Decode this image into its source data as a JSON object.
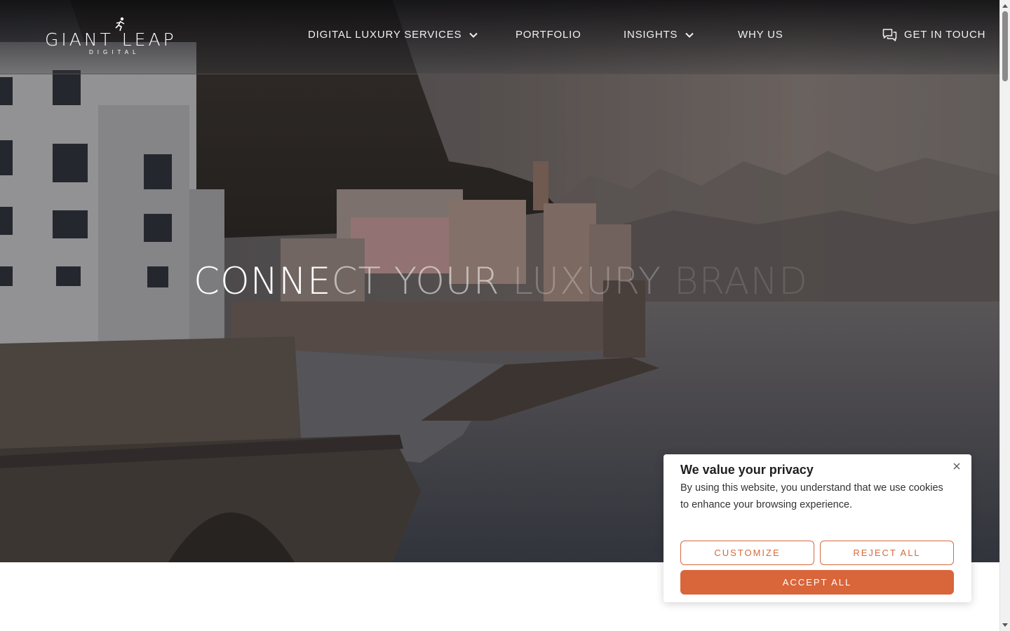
{
  "brand": {
    "logo_word": "GIANT LEAP",
    "logo_sub": "DIGITAL"
  },
  "nav": {
    "items": [
      {
        "label": "DIGITAL LUXURY SERVICES",
        "has_dropdown": true
      },
      {
        "label": "PORTFOLIO",
        "has_dropdown": false
      },
      {
        "label": "INSIGHTS",
        "has_dropdown": true
      },
      {
        "label": "WHY US",
        "has_dropdown": false
      }
    ],
    "contact_label": "GET IN TOUCH",
    "contact_icon": "chat-bubbles-icon"
  },
  "hero": {
    "title_part1": "CONNE",
    "title_part2": "CT YOUR",
    "title_part3": " LUXURY",
    "title_part4": " BRAND"
  },
  "cookie": {
    "title": "We value your privacy",
    "text": "By using this website, you understand that we use cookies to enhance your browsing experience.",
    "customize_label": "CUSTOMIZE",
    "reject_label": "REJECT ALL",
    "accept_label": "ACCEPT ALL",
    "accent_color": "#d9653a"
  }
}
